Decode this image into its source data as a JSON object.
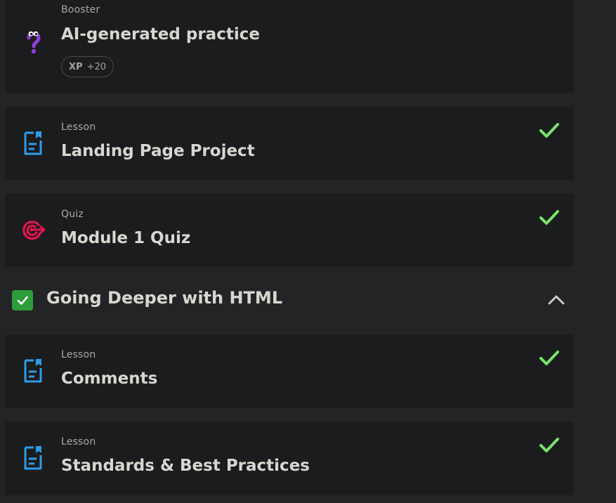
{
  "items_top": [
    {
      "type": "Booster",
      "title": "AI-generated practice",
      "icon": "question-mark-icon",
      "xp": {
        "label": "XP",
        "value": "+20"
      },
      "completed": false
    },
    {
      "type": "Lesson",
      "title": "Landing Page Project",
      "icon": "document-icon",
      "completed": true
    },
    {
      "type": "Quiz",
      "title": "Module 1 Quiz",
      "icon": "target-icon",
      "completed": true
    }
  ],
  "section": {
    "title": "Going Deeper with HTML",
    "completed": true,
    "expanded": true,
    "items": [
      {
        "type": "Lesson",
        "title": "Comments",
        "icon": "document-icon",
        "completed": true
      },
      {
        "type": "Lesson",
        "title": "Standards & Best Practices",
        "icon": "document-icon",
        "completed": true
      }
    ]
  },
  "colors": {
    "background": "#232425",
    "card": "#1b1c1e",
    "check": "#79e36b",
    "lesson_icon": "#2f9be8",
    "quiz_icon": "#e8124f",
    "booster_icon": "#8b3fd9",
    "section_check_bg": "#2d9c3a"
  }
}
